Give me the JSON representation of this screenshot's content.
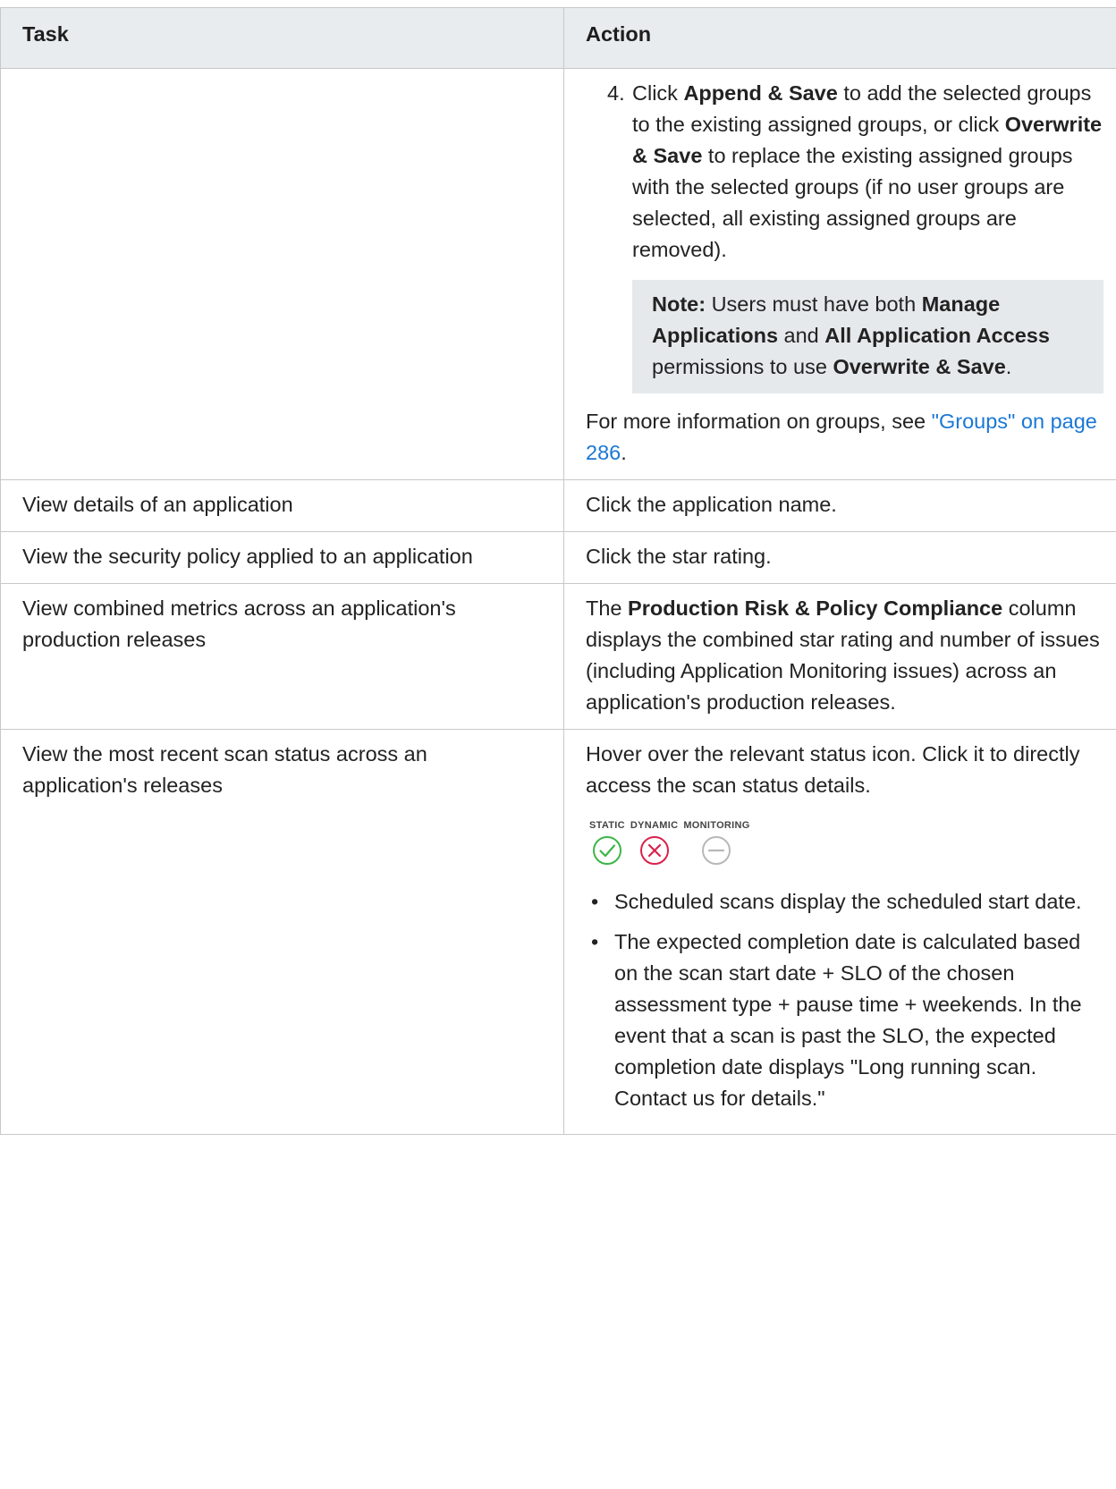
{
  "table": {
    "headers": {
      "task": "Task",
      "action": "Action"
    },
    "row1": {
      "step": {
        "number": "4.",
        "t1": "Click ",
        "b1": "Append & Save",
        "t2": " to add the selected groups to the existing assigned groups, or click ",
        "b2": "Overwrite & Save",
        "t3": " to replace the existing assigned groups with the selected groups (if no user groups are selected, all existing assigned groups are removed)."
      },
      "note": {
        "label": "Note:",
        "t1": " Users must have both ",
        "b1": "Manage Applications",
        "t2": " and ",
        "b2": "All Application Access",
        "t3": " permissions to use ",
        "b3": "Overwrite & Save",
        "t4": "."
      },
      "more": {
        "text": "For more information on groups, see ",
        "link": "\"Groups\" on page 286",
        "end": "."
      }
    },
    "row2": {
      "task": "View details of an application",
      "action": "Click the application name."
    },
    "row3": {
      "task": "View the security policy applied to an application",
      "action": "Click the star rating."
    },
    "row4": {
      "task": "View combined metrics across an application's production releases",
      "a1": "The ",
      "b1": "Production Risk & Policy Compliance",
      "a2": " column displays the combined star rating and number of issues (including Application Monitoring issues) across an application's production releases."
    },
    "row5": {
      "task": "View the most recent scan status across an application's releases",
      "intro": "Hover over the relevant status icon. Click it to directly access the scan status details.",
      "icons": {
        "static": "STATIC",
        "dynamic": "DYNAMIC",
        "monitoring": "MONITORING",
        "static_color": "#3db548",
        "dynamic_color": "#d9214c",
        "monitoring_color": "#b8b8b8"
      },
      "bullets": [
        "Scheduled scans display the scheduled start date.",
        "The expected completion date is calculated based on the scan start date + SLO of the chosen assessment type + pause time + weekends. In the event that a scan is past the SLO, the expected completion date displays \"Long running scan. Contact us for details.\""
      ]
    }
  }
}
